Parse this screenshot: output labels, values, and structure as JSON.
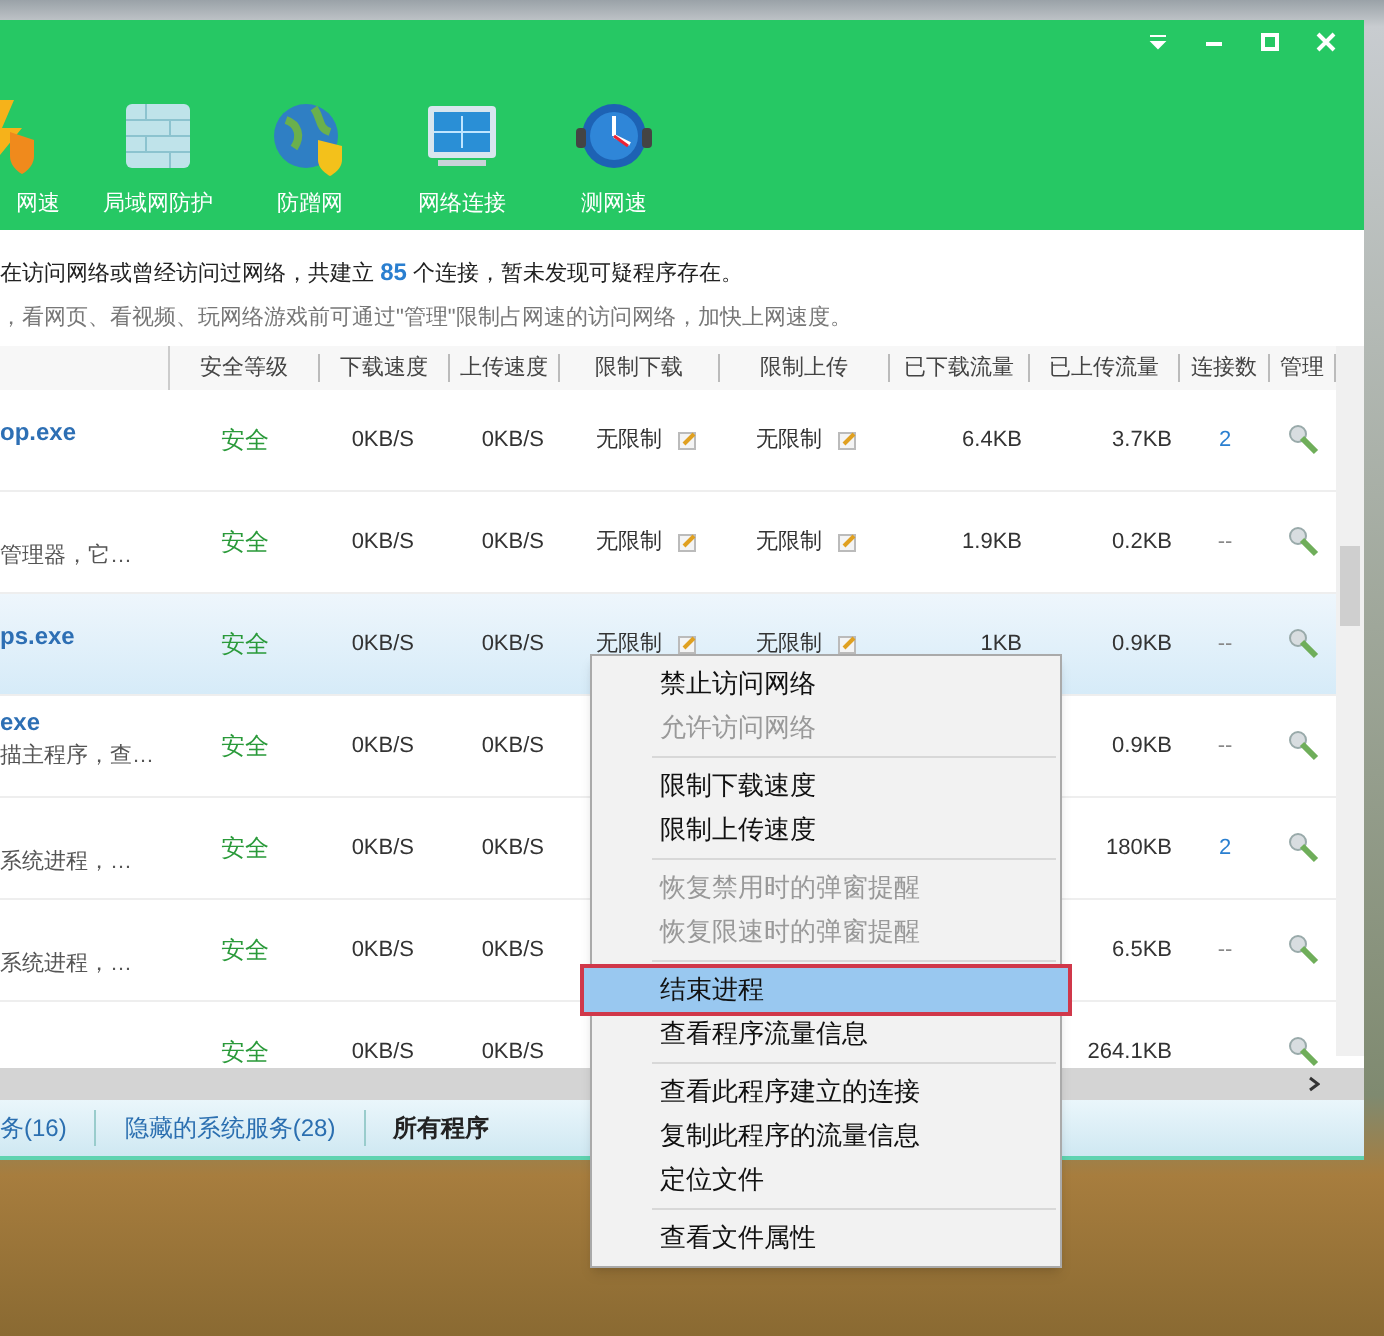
{
  "toolbar": [
    {
      "label": "网速"
    },
    {
      "label": "局域网防护"
    },
    {
      "label": "防蹭网"
    },
    {
      "label": "网络连接"
    },
    {
      "label": "测网速"
    }
  ],
  "info": {
    "line_1_before": "在访问网络或曾经访问过网络，共建立",
    "count": "85",
    "line_1_after": "个连接，暂未发现可疑程序存在。",
    "line_2": "，看网页、看视频、玩网络游戏前可通过\"管理\"限制占网速的访问网络，加快上网速度。"
  },
  "table": {
    "columns": [
      "安全等级",
      "下载速度",
      "上传速度",
      "限制下载",
      "限制上传",
      "已下载流量",
      "已上传流量",
      "连接数",
      "管理"
    ],
    "rows": [
      {
        "name": "op.exe",
        "safety": "安全",
        "down": "0KB/S",
        "up": "0KB/S",
        "limit_down": "无限制",
        "limit_up": "无限制",
        "downloaded": "6.4KB",
        "uploaded": "3.7KB",
        "connections": "2",
        "selected": false
      },
      {
        "desc": "管理器，它…",
        "safety": "安全",
        "down": "0KB/S",
        "up": "0KB/S",
        "limit_down": "无限制",
        "limit_up": "无限制",
        "downloaded": "1.9KB",
        "uploaded": "0.2KB",
        "connections": "--",
        "selected": false
      },
      {
        "name": "ps.exe",
        "safety": "安全",
        "down": "0KB/S",
        "up": "0KB/S",
        "limit_down": "无限制",
        "limit_up": "无限制",
        "downloaded": "1KB",
        "uploaded": "0.9KB",
        "connections": "--",
        "selected": true
      },
      {
        "name": "exe",
        "desc": "描主程序，查…",
        "safety": "安全",
        "down": "0KB/S",
        "up": "0KB/S",
        "uploaded": "0.9KB",
        "connections": "--",
        "selected": false
      },
      {
        "desc": "系统进程，…",
        "safety": "安全",
        "down": "0KB/S",
        "up": "0KB/S",
        "uploaded": "180KB",
        "connections": "2",
        "selected": false
      },
      {
        "desc": "系统进程，…",
        "safety": "安全",
        "down": "0KB/S",
        "up": "0KB/S",
        "uploaded": "6.5KB",
        "connections": "--",
        "selected": false
      },
      {
        "safety": "安全",
        "down": "0KB/S",
        "up": "0KB/S",
        "uploaded": "264.1KB",
        "selected": false
      }
    ]
  },
  "status_tabs": [
    {
      "label": "务(16)",
      "selected": false
    },
    {
      "label": "隐藏的系统服务(28)",
      "selected": false
    },
    {
      "label": "所有程序",
      "selected": true
    }
  ],
  "context_menu": [
    {
      "kind": "item",
      "label": "禁止访问网络",
      "disabled": false,
      "selected": false
    },
    {
      "kind": "item",
      "label": "允许访问网络",
      "disabled": true,
      "selected": false
    },
    {
      "kind": "separator"
    },
    {
      "kind": "item",
      "label": "限制下载速度",
      "disabled": false,
      "selected": false
    },
    {
      "kind": "item",
      "label": "限制上传速度",
      "disabled": false,
      "selected": false
    },
    {
      "kind": "separator"
    },
    {
      "kind": "item",
      "label": "恢复禁用时的弹窗提醒",
      "disabled": true,
      "selected": false
    },
    {
      "kind": "item",
      "label": "恢复限速时的弹窗提醒",
      "disabled": true,
      "selected": false
    },
    {
      "kind": "separator"
    },
    {
      "kind": "item",
      "label": "结束进程",
      "disabled": false,
      "selected": true
    },
    {
      "kind": "item",
      "label": "查看程序流量信息",
      "disabled": false,
      "selected": false
    },
    {
      "kind": "separator"
    },
    {
      "kind": "item",
      "label": "查看此程序建立的连接",
      "disabled": false,
      "selected": false
    },
    {
      "kind": "item",
      "label": "复制此程序的流量信息",
      "disabled": false,
      "selected": false
    },
    {
      "kind": "item",
      "label": "定位文件",
      "disabled": false,
      "selected": false
    },
    {
      "kind": "separator"
    },
    {
      "kind": "item",
      "label": "查看文件属性",
      "disabled": false,
      "selected": false
    }
  ]
}
